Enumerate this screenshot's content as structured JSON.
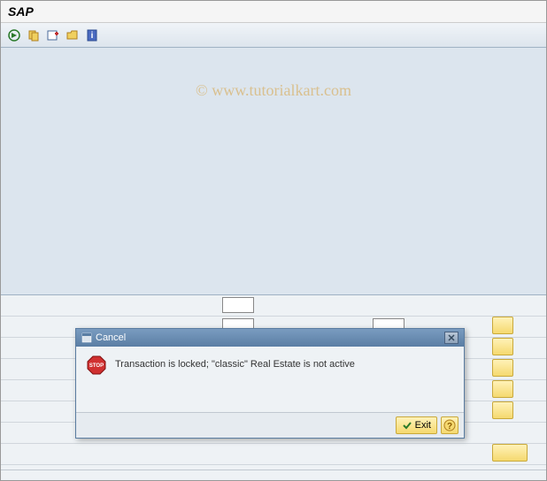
{
  "window": {
    "title": "SAP"
  },
  "watermark": "© www.tutorialkart.com",
  "toolbar": {
    "icons": [
      "execute",
      "copy",
      "create",
      "open",
      "info"
    ]
  },
  "dialog": {
    "title": "Cancel",
    "message": "Transaction is locked; \"classic\" Real Estate is not active",
    "exit_label": "Exit"
  }
}
